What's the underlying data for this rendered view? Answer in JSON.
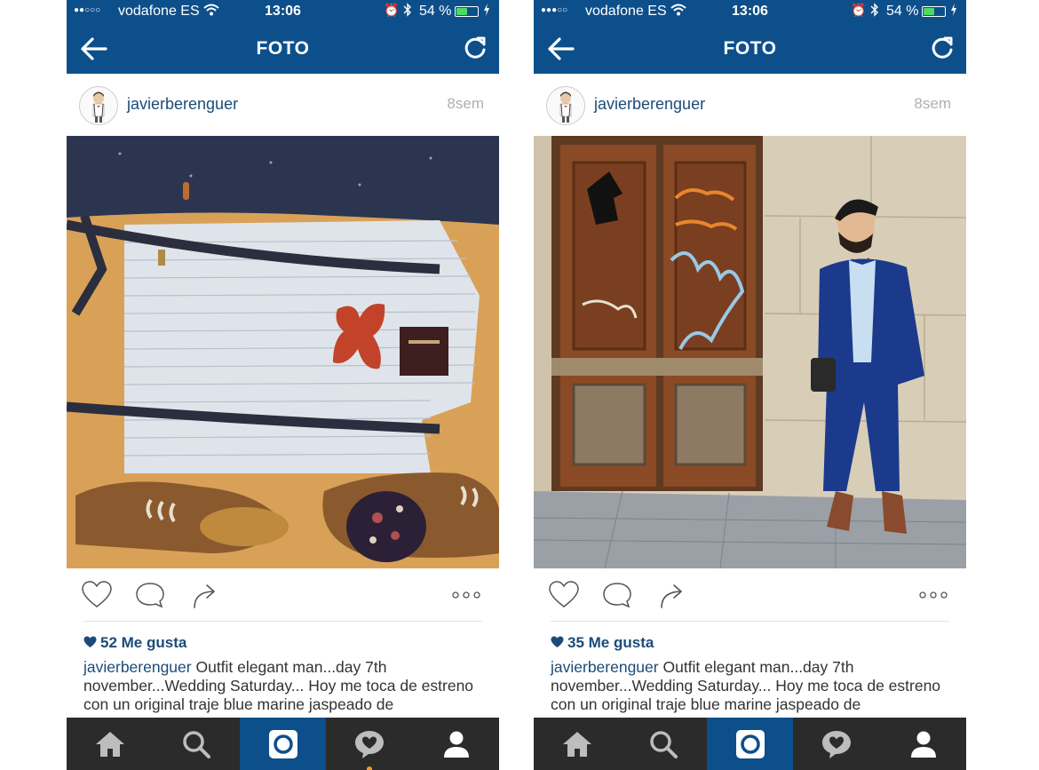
{
  "phones": [
    {
      "status": {
        "signal": "●●○○○",
        "carrier": "vodafone ES",
        "time": "13:06",
        "battery": "54 %",
        "battery_level": 0.54
      },
      "nav": {
        "title": "FOTO",
        "back_icon": "back-arrow-icon",
        "refresh_icon": "refresh-icon"
      },
      "post": {
        "username": "javierberenguer",
        "time_ago": "8sem",
        "photo": "flat-lay outfit: striped shirt, suspenders, red bow tie, brown shoes",
        "likes": "52 Me gusta",
        "caption_user": "javierberenguer",
        "caption_text": " Outfit elegant man...day 7th november...Wedding Saturday... Hoy me toca de estreno con un original traje blue marine jaspeado de"
      }
    },
    {
      "status": {
        "signal": "●●●○○",
        "carrier": "vodafone ES",
        "time": "13:06",
        "battery": "54 %",
        "battery_level": 0.54
      },
      "nav": {
        "title": "FOTO",
        "back_icon": "back-arrow-icon",
        "refresh_icon": "refresh-icon"
      },
      "post": {
        "username": "javierberenguer",
        "time_ago": "8sem",
        "photo": "man in navy suit and red bow tie next to an old wooden door with graffiti",
        "likes": "35 Me gusta",
        "caption_user": "javierberenguer",
        "caption_text": " Outfit elegant man...day 7th november...Wedding Saturday... Hoy me toca de estreno con un original traje blue marine jaspeado de"
      }
    }
  ],
  "tabbar": [
    "home-icon",
    "search-icon",
    "camera-icon",
    "activity-icon",
    "profile-icon"
  ],
  "colors": {
    "brand": "#0d4f8b",
    "tabbar": "#2b2b2b",
    "link": "#1b4b7a",
    "notification": "#f3982b"
  }
}
